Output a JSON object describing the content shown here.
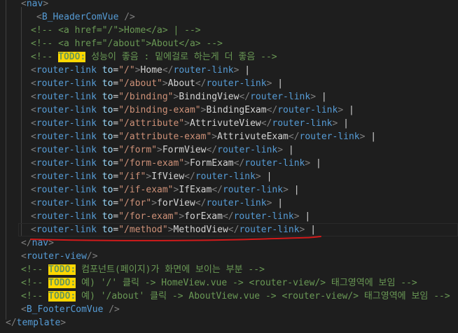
{
  "editor": {
    "lines": [
      [
        [
          "t-punct",
          "<"
        ],
        [
          "t-tag",
          "nav"
        ],
        [
          "t-punct",
          ">"
        ]
      ],
      [
        [
          "t-punct",
          "<"
        ],
        [
          "t-tag",
          "B_HeaderComVue"
        ],
        [
          "t-text",
          " "
        ],
        [
          "t-punct",
          "/>"
        ]
      ],
      [
        [
          "t-cmt",
          "<!-- <a href=\"/\">Home</a> | -->"
        ]
      ],
      [
        [
          "t-cmt",
          "<!-- <a href=\"/about\">About</a> -->"
        ]
      ],
      [
        [
          "t-cmt",
          "<!-- "
        ],
        [
          "t-todo",
          "TODO:"
        ],
        [
          "t-cmt",
          " 성능이 좋음 : 밑에걸로 하는게 더 좋음 -->"
        ]
      ],
      [
        [
          "t-punct",
          "<"
        ],
        [
          "t-tag",
          "router-link"
        ],
        [
          "t-text",
          " "
        ],
        [
          "t-attr",
          "to"
        ],
        [
          "t-text",
          "="
        ],
        [
          "t-str",
          "\"/\""
        ],
        [
          "t-punct",
          ">"
        ],
        [
          "t-text",
          "Home"
        ],
        [
          "t-punct",
          "</"
        ],
        [
          "t-tag",
          "router-link"
        ],
        [
          "t-punct",
          ">"
        ],
        [
          "t-text",
          " |"
        ]
      ],
      [
        [
          "t-punct",
          "<"
        ],
        [
          "t-tag",
          "router-link"
        ],
        [
          "t-text",
          " "
        ],
        [
          "t-attr",
          "to"
        ],
        [
          "t-text",
          "="
        ],
        [
          "t-str",
          "\"/about\""
        ],
        [
          "t-punct",
          ">"
        ],
        [
          "t-text",
          "About"
        ],
        [
          "t-punct",
          "</"
        ],
        [
          "t-tag",
          "router-link"
        ],
        [
          "t-punct",
          ">"
        ],
        [
          "t-text",
          " |"
        ]
      ],
      [
        [
          "t-punct",
          "<"
        ],
        [
          "t-tag",
          "router-link"
        ],
        [
          "t-text",
          " "
        ],
        [
          "t-attr",
          "to"
        ],
        [
          "t-text",
          "="
        ],
        [
          "t-str",
          "\"/binding\""
        ],
        [
          "t-punct",
          ">"
        ],
        [
          "t-text",
          "BindingView"
        ],
        [
          "t-punct",
          "</"
        ],
        [
          "t-tag",
          "router-link"
        ],
        [
          "t-punct",
          ">"
        ],
        [
          "t-text",
          " |"
        ]
      ],
      [
        [
          "t-punct",
          "<"
        ],
        [
          "t-tag",
          "router-link"
        ],
        [
          "t-text",
          " "
        ],
        [
          "t-attr",
          "to"
        ],
        [
          "t-text",
          "="
        ],
        [
          "t-str",
          "\"/binding-exam\""
        ],
        [
          "t-punct",
          ">"
        ],
        [
          "t-text",
          "BindingExam"
        ],
        [
          "t-punct",
          "</"
        ],
        [
          "t-tag",
          "router-link"
        ],
        [
          "t-punct",
          ">"
        ],
        [
          "t-text",
          " |"
        ]
      ],
      [
        [
          "t-punct",
          "<"
        ],
        [
          "t-tag",
          "router-link"
        ],
        [
          "t-text",
          " "
        ],
        [
          "t-attr",
          "to"
        ],
        [
          "t-text",
          "="
        ],
        [
          "t-str",
          "\"/attribute\""
        ],
        [
          "t-punct",
          ">"
        ],
        [
          "t-text",
          "AttrivuteView"
        ],
        [
          "t-punct",
          "</"
        ],
        [
          "t-tag",
          "router-link"
        ],
        [
          "t-punct",
          ">"
        ],
        [
          "t-text",
          " |"
        ]
      ],
      [
        [
          "t-punct",
          "<"
        ],
        [
          "t-tag",
          "router-link"
        ],
        [
          "t-text",
          " "
        ],
        [
          "t-attr",
          "to"
        ],
        [
          "t-text",
          "="
        ],
        [
          "t-str",
          "\"/attribute-exam\""
        ],
        [
          "t-punct",
          ">"
        ],
        [
          "t-text",
          "AttrivuteExam"
        ],
        [
          "t-punct",
          "</"
        ],
        [
          "t-tag",
          "router-link"
        ],
        [
          "t-punct",
          ">"
        ],
        [
          "t-text",
          " |"
        ]
      ],
      [
        [
          "t-punct",
          "<"
        ],
        [
          "t-tag",
          "router-link"
        ],
        [
          "t-text",
          " "
        ],
        [
          "t-attr",
          "to"
        ],
        [
          "t-text",
          "="
        ],
        [
          "t-str",
          "\"/form\""
        ],
        [
          "t-punct",
          ">"
        ],
        [
          "t-text",
          "FormView"
        ],
        [
          "t-punct",
          "</"
        ],
        [
          "t-tag",
          "router-link"
        ],
        [
          "t-punct",
          ">"
        ],
        [
          "t-text",
          " |"
        ]
      ],
      [
        [
          "t-punct",
          "<"
        ],
        [
          "t-tag",
          "router-link"
        ],
        [
          "t-text",
          " "
        ],
        [
          "t-attr",
          "to"
        ],
        [
          "t-text",
          "="
        ],
        [
          "t-str",
          "\"/form-exam\""
        ],
        [
          "t-punct",
          ">"
        ],
        [
          "t-text",
          "FormExam"
        ],
        [
          "t-punct",
          "</"
        ],
        [
          "t-tag",
          "router-link"
        ],
        [
          "t-punct",
          ">"
        ],
        [
          "t-text",
          " |"
        ]
      ],
      [
        [
          "t-punct",
          "<"
        ],
        [
          "t-tag",
          "router-link"
        ],
        [
          "t-text",
          " "
        ],
        [
          "t-attr",
          "to"
        ],
        [
          "t-text",
          "="
        ],
        [
          "t-str",
          "\"/if\""
        ],
        [
          "t-punct",
          ">"
        ],
        [
          "t-text",
          "IfView"
        ],
        [
          "t-punct",
          "</"
        ],
        [
          "t-tag",
          "router-link"
        ],
        [
          "t-punct",
          ">"
        ],
        [
          "t-text",
          " |"
        ]
      ],
      [
        [
          "t-punct",
          "<"
        ],
        [
          "t-tag",
          "router-link"
        ],
        [
          "t-text",
          " "
        ],
        [
          "t-attr",
          "to"
        ],
        [
          "t-text",
          "="
        ],
        [
          "t-str",
          "\"/if-exam\""
        ],
        [
          "t-punct",
          ">"
        ],
        [
          "t-text",
          "IfExam"
        ],
        [
          "t-punct",
          "</"
        ],
        [
          "t-tag",
          "router-link"
        ],
        [
          "t-punct",
          ">"
        ],
        [
          "t-text",
          " |"
        ]
      ],
      [
        [
          "t-punct",
          "<"
        ],
        [
          "t-tag",
          "router-link"
        ],
        [
          "t-text",
          " "
        ],
        [
          "t-attr",
          "to"
        ],
        [
          "t-text",
          "="
        ],
        [
          "t-str",
          "\"/for\""
        ],
        [
          "t-punct",
          ">"
        ],
        [
          "t-text",
          "forView"
        ],
        [
          "t-punct",
          "</"
        ],
        [
          "t-tag",
          "router-link"
        ],
        [
          "t-punct",
          ">"
        ],
        [
          "t-text",
          " |"
        ]
      ],
      [
        [
          "t-punct",
          "<"
        ],
        [
          "t-tag",
          "router-link"
        ],
        [
          "t-text",
          " "
        ],
        [
          "t-attr",
          "to"
        ],
        [
          "t-text",
          "="
        ],
        [
          "t-str",
          "\"/for-exam\""
        ],
        [
          "t-punct",
          ">"
        ],
        [
          "t-text",
          "forExam"
        ],
        [
          "t-punct",
          "</"
        ],
        [
          "t-tag",
          "router-link"
        ],
        [
          "t-punct",
          ">"
        ],
        [
          "t-text",
          " |"
        ]
      ],
      [
        [
          "t-punct",
          "<"
        ],
        [
          "t-tag",
          "router-link"
        ],
        [
          "t-text",
          " "
        ],
        [
          "t-attr",
          "to"
        ],
        [
          "t-text",
          "="
        ],
        [
          "t-str",
          "\"/method\""
        ],
        [
          "t-punct",
          ">"
        ],
        [
          "t-text",
          "MethodView"
        ],
        [
          "t-punct",
          "</"
        ],
        [
          "t-tag",
          "router-link"
        ],
        [
          "t-punct",
          ">"
        ],
        [
          "t-text",
          " |"
        ]
      ],
      [
        [
          "t-punct",
          "</"
        ],
        [
          "t-tag",
          "nav"
        ],
        [
          "t-punct",
          ">"
        ]
      ],
      [
        [
          "t-punct",
          "<"
        ],
        [
          "t-tag",
          "router-view"
        ],
        [
          "t-punct",
          "/>"
        ]
      ],
      [
        [
          "t-cmt",
          "<!-- "
        ],
        [
          "t-todo",
          "TODO:"
        ],
        [
          "t-cmt",
          " 컴포넌트(페이지)가 화면에 보이는 부분 -->"
        ]
      ],
      [
        [
          "t-cmt",
          "<!-- "
        ],
        [
          "t-todo",
          "TODO:"
        ],
        [
          "t-cmt",
          " 예) '/' 클릭 -> HomeView.vue -> <router-view/> 태그영역에 보임 -->"
        ]
      ],
      [
        [
          "t-cmt",
          "<!-- "
        ],
        [
          "t-todo",
          "TODO:"
        ],
        [
          "t-cmt",
          " 예) '/about' 클릭 -> AboutView.vue -> <router-view/> 태그영역에 보임 -->"
        ]
      ],
      [
        [
          "t-punct",
          "<"
        ],
        [
          "t-tag",
          "B_FooterComVue"
        ],
        [
          "t-text",
          " "
        ],
        [
          "t-punct",
          "/>"
        ]
      ],
      [
        [
          "t-punct",
          "</"
        ],
        [
          "t-tag",
          "template"
        ],
        [
          "t-punct",
          ">"
        ]
      ]
    ]
  }
}
